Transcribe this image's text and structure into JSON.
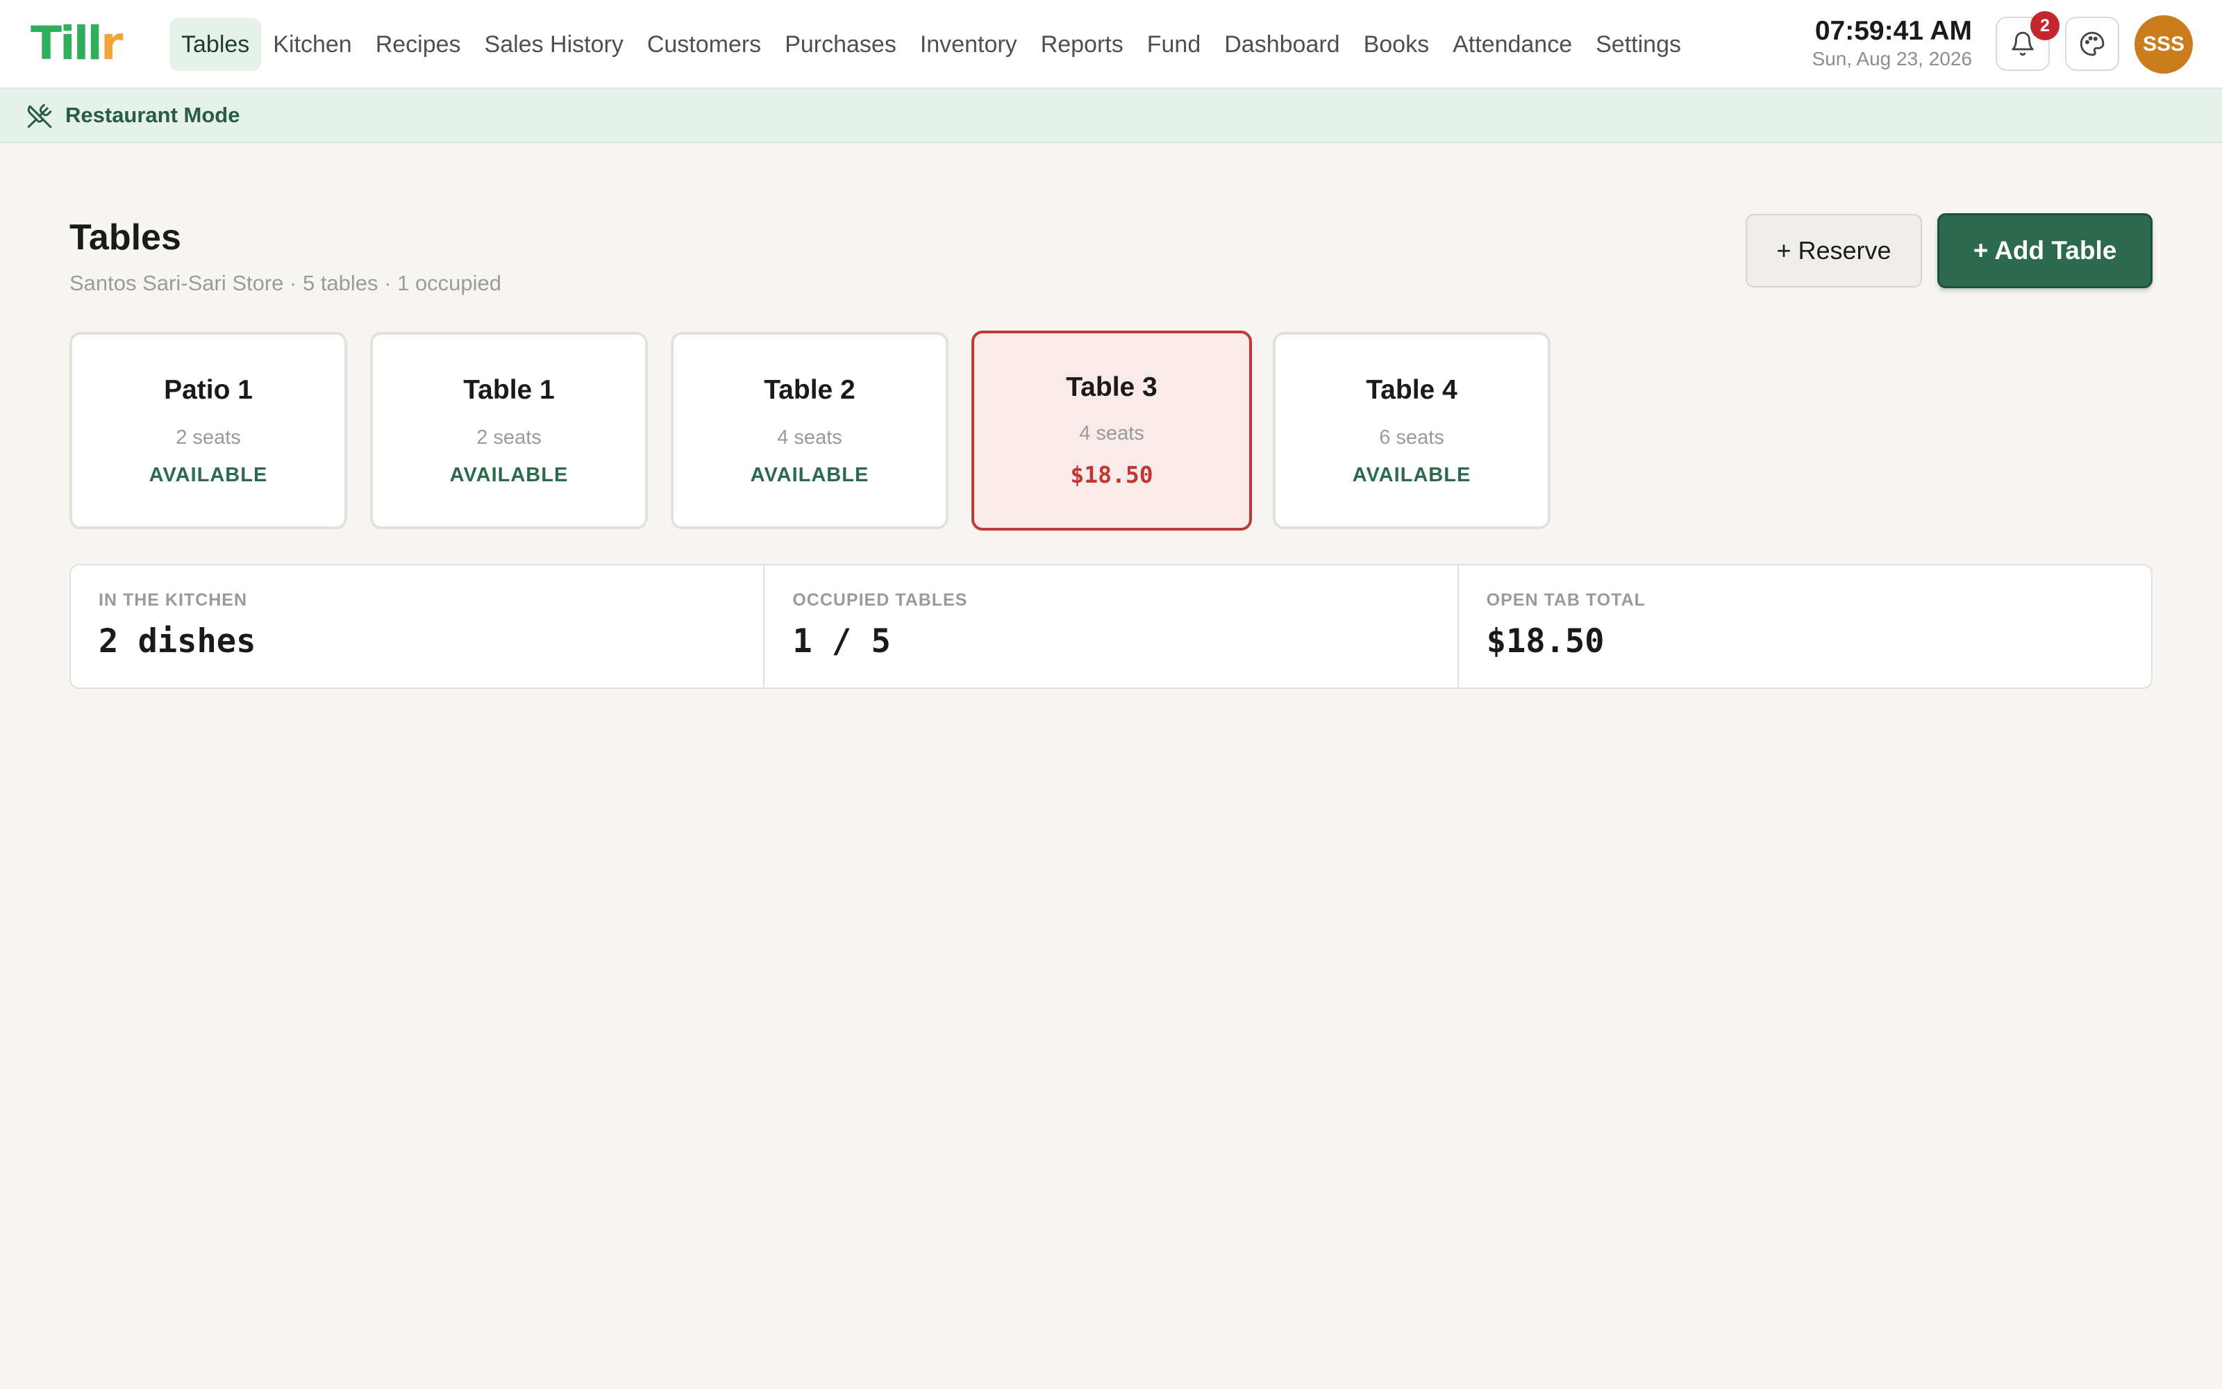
{
  "brand": {
    "part1": "Till",
    "part2": "r"
  },
  "nav": [
    {
      "label": "Tables",
      "active": true
    },
    {
      "label": "Kitchen"
    },
    {
      "label": "Recipes"
    },
    {
      "label": "Sales History"
    },
    {
      "label": "Customers"
    },
    {
      "label": "Purchases"
    },
    {
      "label": "Inventory"
    },
    {
      "label": "Reports"
    },
    {
      "label": "Fund"
    },
    {
      "label": "Dashboard"
    },
    {
      "label": "Books"
    },
    {
      "label": "Attendance"
    },
    {
      "label": "Settings"
    }
  ],
  "clock": {
    "time": "07:59:41 AM",
    "date": "Sun, Aug 23, 2026"
  },
  "notifications": {
    "count": "2",
    "icon": "bell-icon"
  },
  "theme_icon": "palette-icon",
  "user": {
    "initials": "SSS"
  },
  "mode": {
    "label": "Restaurant Mode",
    "icon": "utensils-crossed-icon"
  },
  "page": {
    "title": "Tables",
    "subtitle": "Santos Sari-Sari Store · 5 tables · 1 occupied",
    "reserve_label": "+ Reserve",
    "add_table_label": "+ Add Table"
  },
  "tables": [
    {
      "name": "Patio 1",
      "seats": "2 seats",
      "status": "AVAILABLE",
      "occupied": false
    },
    {
      "name": "Table 1",
      "seats": "2 seats",
      "status": "AVAILABLE",
      "occupied": false
    },
    {
      "name": "Table 2",
      "seats": "4 seats",
      "status": "AVAILABLE",
      "occupied": false
    },
    {
      "name": "Table 3",
      "seats": "4 seats",
      "status": "$18.50",
      "occupied": true
    },
    {
      "name": "Table 4",
      "seats": "6 seats",
      "status": "AVAILABLE",
      "occupied": false
    }
  ],
  "stats": [
    {
      "label": "IN THE KITCHEN",
      "value": "2 dishes"
    },
    {
      "label": "OCCUPIED TABLES",
      "value": "1 / 5"
    },
    {
      "label": "OPEN TAB TOTAL",
      "value": "$18.50"
    }
  ],
  "colors": {
    "brand_green": "#2fae5c",
    "brand_orange": "#f2a33a",
    "primary": "#2c6a4f",
    "occupied_red": "#c23531",
    "avatar": "#cb7c1d"
  }
}
